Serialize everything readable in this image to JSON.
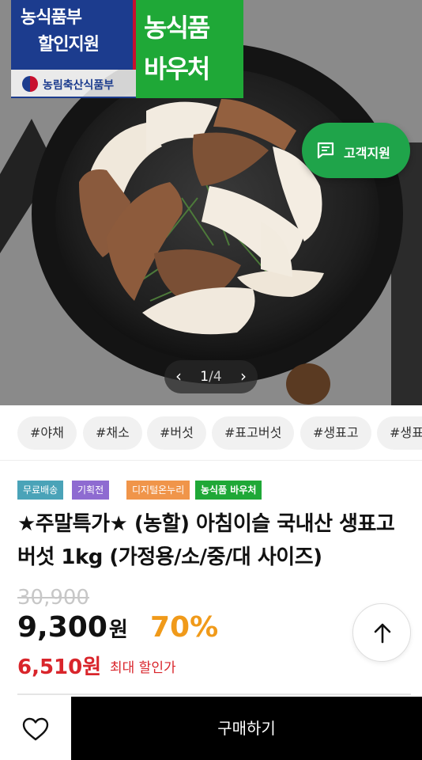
{
  "hero": {
    "ministry_badge": {
      "line1": "농식품부",
      "line2": "할인지원",
      "ministry_name": "농림축산식품부"
    },
    "voucher_badge": {
      "line1": "농식품",
      "line2": "바우처"
    },
    "support_button": {
      "label": "고객지원",
      "icon": "chat-bubble-icon"
    },
    "pager": {
      "current": "1",
      "separator": "/",
      "total": "4",
      "prev": "‹",
      "next": "›"
    }
  },
  "tags": [
    "#야채",
    "#채소",
    "#버섯",
    "#표고버섯",
    "#생표고",
    "#생표고버섯"
  ],
  "chips": [
    {
      "label": "무료배송",
      "color": "#4aa3b8"
    },
    {
      "label": "기획전",
      "color": "#8e6bd1"
    },
    {
      "label": "디지털온누리",
      "color": "#f0954a"
    },
    {
      "label": "농식품 바우처",
      "color": "#1fa837"
    }
  ],
  "product": {
    "title": "★주말특가★ (농할) 아침이슬 국내산 생표고버섯 1kg (가정용/소/중/대 사이즈)",
    "original_price": "30,900",
    "price": "9,300",
    "price_unit": "원",
    "discount_rate": "70%",
    "max_price": "6,510원",
    "max_label": "최대 할인가"
  },
  "buttons": {
    "buy": "구매하기",
    "wish_icon": "heart-icon",
    "top_icon": "arrow-up-icon"
  },
  "colors": {
    "accent_green": "#1fa44a",
    "discount_orange": "#f09a1a",
    "max_red": "#d9252b"
  }
}
